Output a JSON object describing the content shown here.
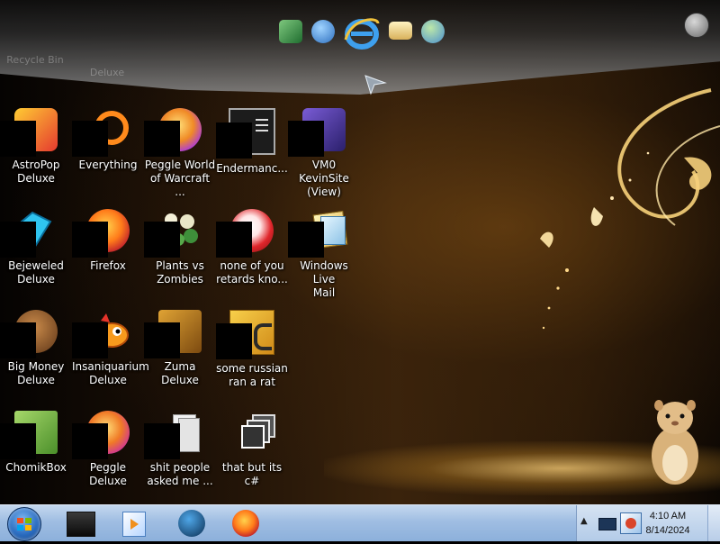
{
  "desktop": {
    "ghost_labels": [
      "Recycle Bin",
      "Deluxe"
    ],
    "icons": [
      {
        "label": "AstroPop\nDeluxe",
        "icon": "astropop-icon"
      },
      {
        "label": "Everything",
        "icon": "everything-icon"
      },
      {
        "label": "Peggle World\nof Warcraft ...",
        "icon": "peggle-wow-icon"
      },
      {
        "label": "Endermanc...",
        "icon": "terminal-icon"
      },
      {
        "label": "VM0 KevinSite\n(View)",
        "icon": "vm-icon"
      },
      {
        "label": "Bejeweled\nDeluxe",
        "icon": "bejeweled-icon"
      },
      {
        "label": "Firefox",
        "icon": "firefox-icon"
      },
      {
        "label": "Plants vs\nZombies",
        "icon": "plants-vs-zombies-icon"
      },
      {
        "label": "none of you\nretards kno...",
        "icon": "peggle-icon"
      },
      {
        "label": "Windows Live\nMail",
        "icon": "windows-live-mail-icon"
      },
      {
        "label": "Big Money\nDeluxe",
        "icon": "big-money-icon"
      },
      {
        "label": "Insaniquarium\nDeluxe",
        "icon": "insaniquarium-icon"
      },
      {
        "label": "Zuma Deluxe",
        "icon": "zuma-icon"
      },
      {
        "label": "some russian\nran a rat",
        "icon": "document-icon"
      },
      {
        "label": "ChomikBox",
        "icon": "chomikbox-icon"
      },
      {
        "label": "Peggle Deluxe",
        "icon": "peggle-deluxe-icon"
      },
      {
        "label": "shit people\nasked me ...",
        "icon": "folder-icon"
      },
      {
        "label": "that but its c#",
        "icon": "shortcut-files-icon"
      }
    ]
  },
  "dock": {
    "items": [
      "sheets-icon",
      "network-globe-icon",
      "internet-explorer-icon",
      "mail-envelope-icon",
      "users-icon"
    ]
  },
  "taskbar": {
    "items": [
      "app-window-icon",
      "media-player-icon",
      "globe-app-icon",
      "firefox-icon"
    ],
    "clock": {
      "time": "4:10 AM",
      "date": "8/14/2024"
    }
  },
  "colors": {
    "taskbar": "#9fbde2",
    "label_text": "#ffffff",
    "accent_glow": "#f2c26a"
  }
}
